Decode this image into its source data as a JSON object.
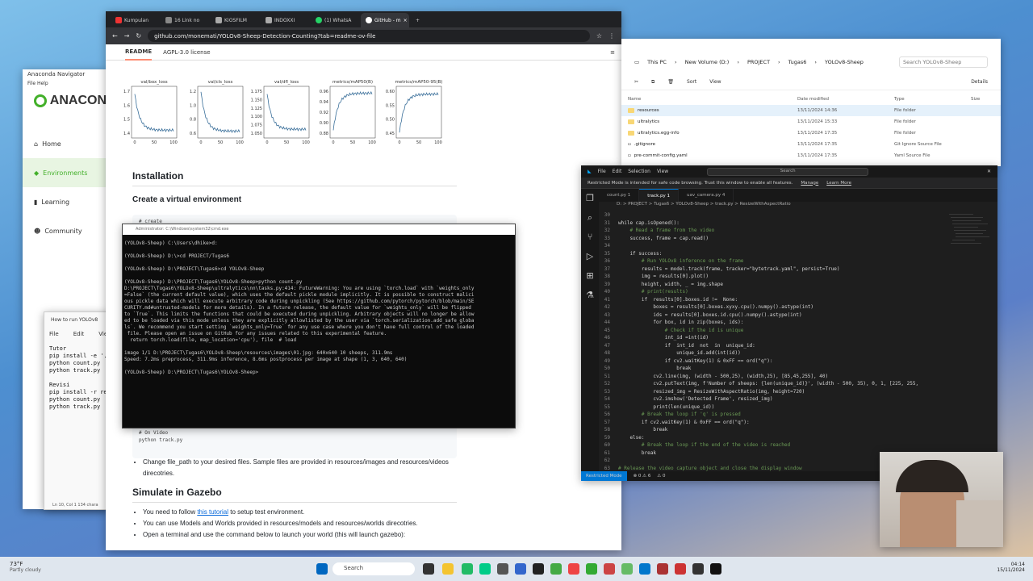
{
  "anaconda": {
    "title": "Anaconda Navigator",
    "menu": "File  Help",
    "logo": "ANACON",
    "nav": [
      "Home",
      "Environments",
      "Learning",
      "Community"
    ]
  },
  "notepad": {
    "title": "How to run YOLOv8",
    "menu": [
      "File",
      "Edit",
      "View"
    ],
    "content": "Tutor\npip install -e '.\npython count.py\npython track.py\n\nRevisi\npip install -r re\npython count.py\npython track.py",
    "status": "Ln 10, Col 1    134 chara"
  },
  "chrome": {
    "tabs": [
      "Kumpulan",
      "16 Link no",
      "KIOSFILM",
      "INDOXXI",
      "(1) WhatsA",
      "GitHub - m"
    ],
    "url": "github.com/monemati/YOLOv8-Sheep-Detection-Counting?tab=readme-ov-file",
    "readme_tabs": [
      "README",
      "AGPL-3.0 license"
    ],
    "plots": [
      {
        "title": "val/box_loss",
        "yt": [
          "1.7",
          "1.6",
          "1.5",
          "1.4"
        ]
      },
      {
        "title": "val/cls_loss",
        "yt": [
          "1.2",
          "1.0",
          "0.8",
          "0.6"
        ]
      },
      {
        "title": "val/dfl_loss",
        "yt": [
          "1.175",
          "1.150",
          "1.125",
          "1.100",
          "1.075",
          "1.050"
        ]
      },
      {
        "title": "metrics/mAP50(B)",
        "yt": [
          "0.96",
          "0.94",
          "0.92",
          "0.90",
          "0.88"
        ]
      },
      {
        "title": "metrics/mAP50-95(B)",
        "yt": [
          "0.60",
          "0.55",
          "0.50",
          "0.45"
        ]
      }
    ],
    "xt": [
      "0",
      "50",
      "100"
    ],
    "installation": "Installation",
    "create_env": "Create a virtual environment",
    "code1": "# create",
    "code2a": "# On Video",
    "code2b": "python track.py",
    "li1": "Change file_path to your desired files. Sample files are provided in resources/images and resources/videos",
    "li1b": "direcotries.",
    "sim": "Simulate in Gazebo",
    "li2a": "You need to follow ",
    "li2link": "this tutorial",
    "li2b": " to setup test environment.",
    "li3": "You can use Models and Worlds provided in resources/models and resources/worlds direcotries.",
    "li4": "Open a terminal and use the command below to launch your world (this will launch gazebo):"
  },
  "cmd": {
    "title": "Administrator: C:\\Windows\\system32\\cmd.exe",
    "text": "(YOLOv8-Sheep) C:\\Users\\dhike>d:\n\n(YOLOv8-Sheep) D:\\>cd PROJECT/Tugas6\n\n(YOLOv8-Sheep) D:\\PROJECT\\Tugas6>cd YOLOv8-Sheep\n\n(YOLOv8-Sheep) D:\\PROJECT\\Tugas6\\YOLOv8-Sheep>python count.py\nD:\\PROJECT\\Tugas6\\YOLOv8-Sheep\\ultralytics\\nn\\tasks.py:414: FutureWarning: You are using `torch.load` with `weights_only\n=False` (the current default value), which uses the default pickle module implicitly. It is possible to construct malici\nous pickle data which will execute arbitrary code during unpickling (See https://github.com/pytorch/pytorch/blob/main/SE\nCURITY.md#untrusted-models for more details). In a future release, the default value for `weights_only` will be flipped\nto `True`. This limits the functions that could be executed during unpickling. Arbitrary objects will no longer be allow\ned to be loaded via this mode unless they are explicitly allowlisted by the user via `torch.serialization.add_safe_globa\nls`. We recommend you start setting `weights_only=True` for any use case where you don't have full control of the loaded\n file. Please open an issue on GitHub for any issues related to this experimental feature.\n  return torch.load(file, map_location='cpu'), file  # load\n\nimage 1/1 D:\\PROJECT\\Tugas6\\YOLOv8-Sheep\\resources\\images\\01.jpg: 640x640 10 sheeps, 311.9ms\nSpeed: 7.2ms preprocess, 311.9ms inference, 8.6ms postprocess per image at shape (1, 3, 640, 640)\n\n(YOLOv8-Sheep) D:\\PROJECT\\Tugas6\\YOLOv8-Sheep>"
  },
  "explorer": {
    "path": [
      "This PC",
      "New Volume (D:)",
      "PROJECT",
      "Tugas6",
      "YOLOv8-Sheep"
    ],
    "search": "Search YOLOv8-Sheep",
    "sort": "Sort",
    "view": "View",
    "details": "Details",
    "cols": [
      "Name",
      "Date modified",
      "Type",
      "Size"
    ],
    "rows": [
      [
        "resources",
        "13/11/2024 14:36",
        "File folder"
      ],
      [
        "ultralytics",
        "13/11/2024 15:33",
        "File folder"
      ],
      [
        "ultralytics.egg-info",
        "13/11/2024 17:35",
        "File folder"
      ],
      [
        ".gitignore",
        "13/11/2024 17:35",
        "Git Ignore Source File"
      ],
      [
        "pre-commit-config.yaml",
        "13/11/2024 17:35",
        "Yaml Source File"
      ]
    ]
  },
  "vscode": {
    "menu": [
      "File",
      "Edit",
      "Selection",
      "View"
    ],
    "search": "Search",
    "banner": "Restricted Mode is intended for safe code browsing. Trust this window to enable all features.",
    "manage": "Manage",
    "learn": "Learn More",
    "tabs": [
      "count.py 1",
      "track.py 1",
      "uav_camera.py 4"
    ],
    "crumbs": "D: > PROJECT > Tugas6 > YOLOv8-Sheep > track.py > ResizeWithAspectRatio",
    "lines": [
      [
        "30",
        ""
      ],
      [
        "31",
        "while cap.isOpened():"
      ],
      [
        "32",
        "    # Read a frame from the video"
      ],
      [
        "33",
        "    success, frame = cap.read()"
      ],
      [
        "34",
        ""
      ],
      [
        "35",
        "    if success:"
      ],
      [
        "36",
        "        # Run YOLOv8 inference on the frame"
      ],
      [
        "37",
        "        results = model.track(frame, tracker=\"bytetrack.yaml\", persist=True)"
      ],
      [
        "38",
        "        img = results[0].plot()"
      ],
      [
        "39",
        "        height, width, _ = img.shape"
      ],
      [
        "40",
        "        # print(results)"
      ],
      [
        "41",
        "        if  results[0].boxes.id !=  None:"
      ],
      [
        "42",
        "            boxes = results[0].boxes.xyxy.cpu().numpy().astype(int)"
      ],
      [
        "43",
        "            ids = results[0].boxes.id.cpu().numpy().astype(int)"
      ],
      [
        "44",
        "            for box, id in zip(boxes, ids):"
      ],
      [
        "45",
        "                # Check if the id is unique"
      ],
      [
        "46",
        "                int_id =int(id)"
      ],
      [
        "47",
        "                if  int_id  not  in  unique_id:"
      ],
      [
        "48",
        "                    unique_id.add(int(id))"
      ],
      [
        "49",
        "                if cv2.waitKey(1) & 0xFF == ord(\"q\"):"
      ],
      [
        "50",
        "                    break"
      ],
      [
        "51",
        "            cv2.line(img, (width - 500,25), (width,25), [85,45,255], 40)"
      ],
      [
        "52",
        "            cv2.putText(img, f'Number of sheeps: {len(unique_id)}', (width - 500, 35), 0, 1, [225, 255,"
      ],
      [
        "53",
        "            resized_img = ResizeWithAspectRatio(img, height=720)"
      ],
      [
        "54",
        "            cv2.imshow('Detected Frame', resized_img)"
      ],
      [
        "55",
        "            print(len(unique_id))"
      ],
      [
        "56",
        "        # Break the loop if 'q' is pressed"
      ],
      [
        "57",
        "        if cv2.waitKey(1) & 0xFF == ord(\"q\"):"
      ],
      [
        "58",
        "            break"
      ],
      [
        "59",
        "    else:"
      ],
      [
        "60",
        "        # Break the loop if the end of the video is reached"
      ],
      [
        "61",
        "        break"
      ],
      [
        "62",
        ""
      ],
      [
        "63",
        "# Release the video capture object and close the display window"
      ]
    ],
    "status": [
      "Restricted Mode",
      "⊗ 0 ⚠ 6",
      "⚠ 0"
    ]
  },
  "taskbar": {
    "weather": "73°F",
    "weather2": "Partly cloudy",
    "search": "Search",
    "time": "04:14",
    "date": "15/11/2024"
  }
}
